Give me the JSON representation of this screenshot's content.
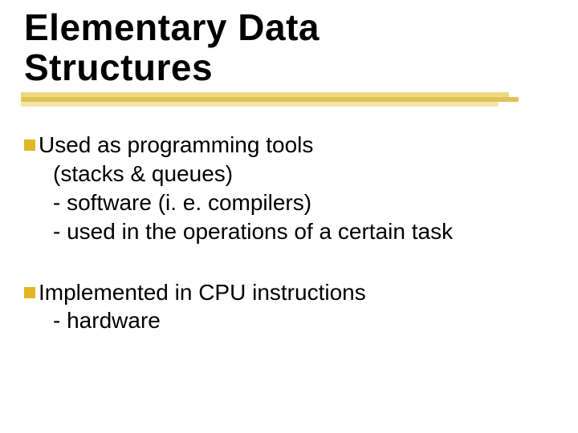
{
  "title_line1": "Elementary Data",
  "title_line2": "Structures",
  "bullets": [
    {
      "first": "Used as programming tools",
      "lines": [
        "(stacks & queues)",
        "- software (i. e. compilers)",
        "- used in the operations of a certain task"
      ]
    },
    {
      "first": "Implemented in CPU instructions",
      "lines": [
        "- hardware"
      ]
    }
  ]
}
